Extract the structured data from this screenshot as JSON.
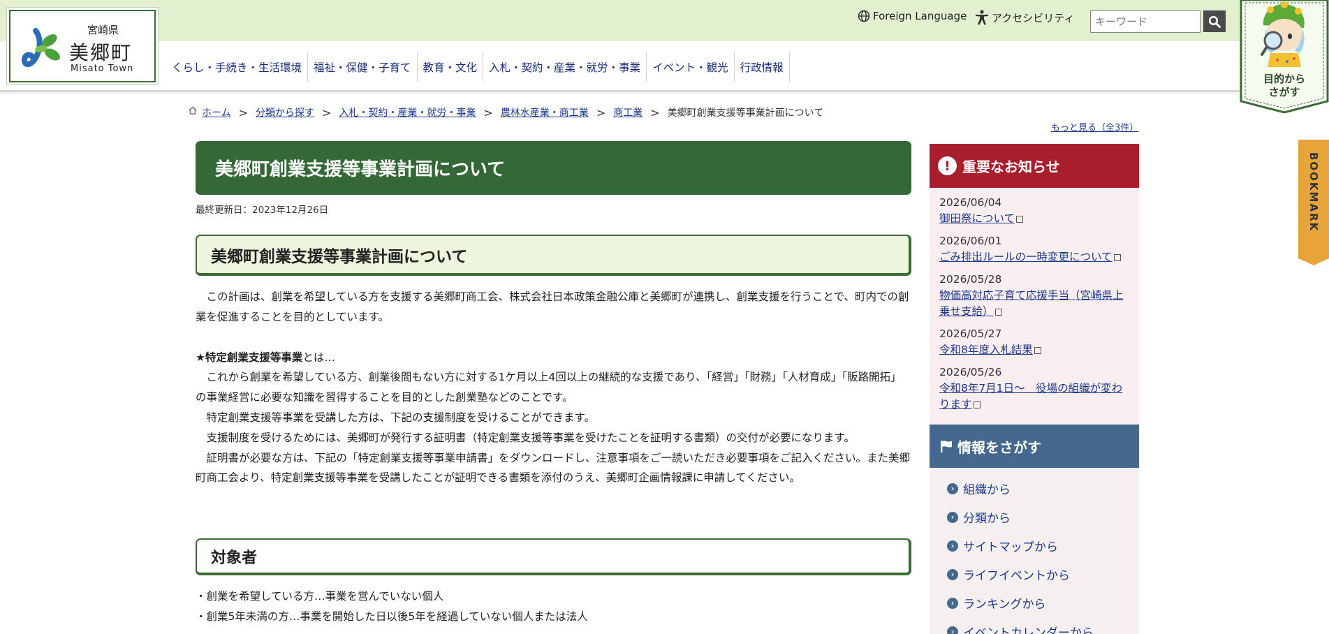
{
  "header": {
    "logo_pref": "宮崎県",
    "logo_name": "美郷町",
    "logo_en": "Misato Town",
    "foreign_language": "Foreign Language",
    "accessibility": "アクセシビリティ",
    "search_placeholder": "キーワード"
  },
  "gnav": [
    {
      "label": "くらし・手続き・生活環境"
    },
    {
      "label": "福祉・保健・子育て"
    },
    {
      "label": "教育・文化"
    },
    {
      "label": "入札・契約・産業・就労・事業"
    },
    {
      "label": "イベント・観光"
    },
    {
      "label": "行政情報"
    }
  ],
  "mascot": {
    "label_line1": "目的から",
    "label_line2": "さがす"
  },
  "bookmark": {
    "label": "BOOKMARK"
  },
  "breadcrumb": {
    "items": [
      "ホーム",
      "分類から探す",
      "入札・契約・産業・就労・事業",
      "農林水産業・商工業",
      "商工業"
    ],
    "current": "美郷町創業支援等事業計画について",
    "more": "もっと見る（全3件）"
  },
  "main": {
    "title": "美郷町創業支援等事業計画について",
    "updated": "最終更新日：2023年12月26日",
    "h2": "美郷町創業支援等事業計画について",
    "para1": "　この計画は、創業を希望している方を支援する美郷町商工会、株式会社日本政策金融公庫と美郷町が連携し、創業支援を行うことで、町内での創業を促進することを目的としています。",
    "strong_label": "★特定創業支援等事業",
    "strong_suffix": "とは…",
    "para2": "　これから創業を希望している方、創業後間もない方に対する1ケ月以上4回以上の継続的な支援であり、「経営」「財務」「人材育成」「販路開拓」の事業経営に必要な知識を習得することを目的とした創業塾などのことです。",
    "para3": "　特定創業支援等事業を受講した方は、下記の支援制度を受けることができます。",
    "para4": "　支援制度を受けるためには、美郷町が発行する証明書（特定創業支援等事業を受けたことを証明する書類）の交付が必要になります。",
    "para5": "　証明書が必要な方は、下記の「特定創業支援等事業申請書」をダウンロードし、注意事項をご一読いただき必要事項をご記入ください。また美郷町商工会より、特定創業支援等事業を受講したことが証明できる書類を添付のうえ、美郷町企画情報課に申請してください。",
    "h3": "対象者",
    "list": [
      "・創業を希望している方…事業を営んでいない個人",
      "・創業5年未満の方…事業を開始した日以後5年を経過していない個人または法人"
    ]
  },
  "notice": {
    "title": "重要なお知らせ",
    "items": [
      {
        "date": "2026/06/04",
        "text": "御田祭について"
      },
      {
        "date": "2026/06/01",
        "text": "ごみ排出ルールの一時変更について"
      },
      {
        "date": "2026/05/28",
        "text": "物価高対応子育て応援手当（宮崎県上乗せ支給）"
      },
      {
        "date": "2026/05/27",
        "text": "令和8年度入札結果"
      },
      {
        "date": "2026/05/26",
        "text": "令和8年7月1日〜　役場の組織が変わります"
      }
    ]
  },
  "find": {
    "title": "情報をさがす",
    "items": [
      "組織から",
      "分類から",
      "サイトマップから",
      "ライフイベントから",
      "ランキングから",
      "イベントカレンダーから"
    ]
  },
  "colors": {
    "title_green": "#346836",
    "header_green": "#e2f0cf",
    "notice_red": "#a81e2d",
    "find_blue": "#45698c",
    "bookmark_orange": "#e6a43a"
  }
}
